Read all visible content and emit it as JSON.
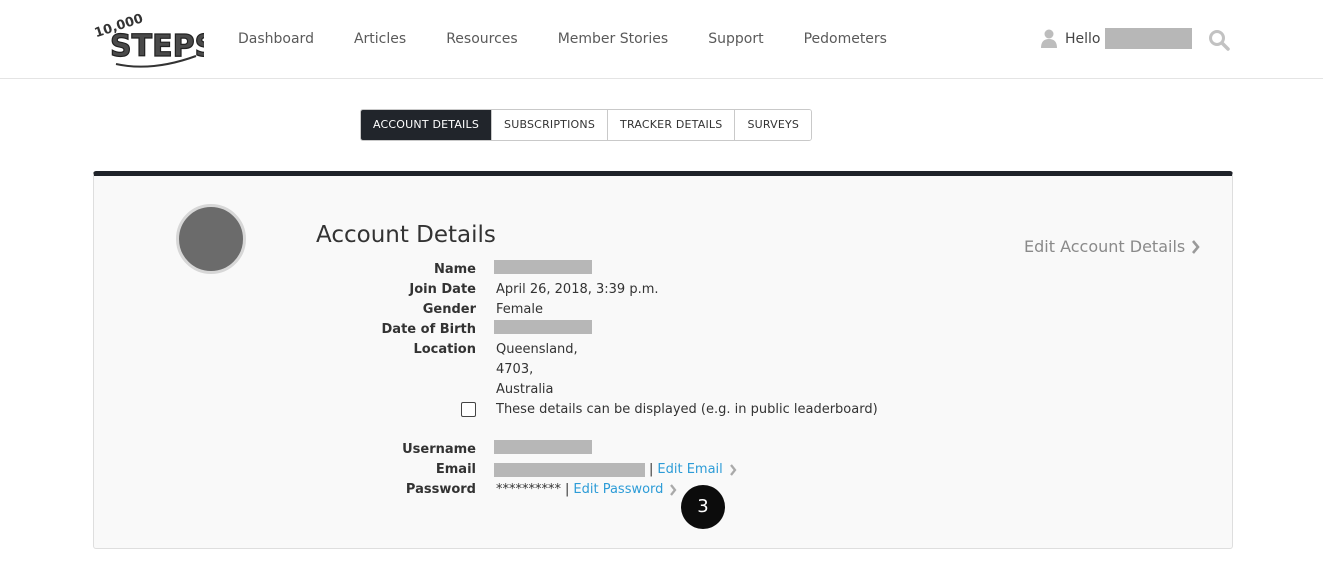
{
  "logo": {
    "top_text": "10,000",
    "main_text": "STEPS"
  },
  "nav": {
    "items": [
      "Dashboard",
      "Articles",
      "Resources",
      "Member Stories",
      "Support",
      "Pedometers"
    ]
  },
  "user": {
    "greeting": "Hello"
  },
  "tabs": [
    {
      "label": "ACCOUNT DETAILS",
      "active": true
    },
    {
      "label": "SUBSCRIPTIONS",
      "active": false
    },
    {
      "label": "TRACKER DETAILS",
      "active": false
    },
    {
      "label": "SURVEYS",
      "active": false
    }
  ],
  "account": {
    "title": "Account Details",
    "edit_label": "Edit Account Details",
    "fields": {
      "name_label": "Name",
      "join_label": "Join Date",
      "join_value": "April 26, 2018, 3:39 p.m.",
      "gender_label": "Gender",
      "gender_value": "Female",
      "dob_label": "Date of Birth",
      "location_label": "Location",
      "location_lines": [
        "Queensland,",
        "4703,",
        "Australia"
      ],
      "public_checkbox_label": "These details can be displayed (e.g. in public leaderboard)",
      "username_label": "Username",
      "email_label": "Email",
      "edit_email": "Edit Email",
      "password_label": "Password",
      "password_mask": "**********",
      "edit_password": "Edit Password"
    }
  },
  "step_badge": "3",
  "colors": {
    "accent_link": "#2d9cd7",
    "dark": "#21252b",
    "redaction": "#b7b7b7"
  }
}
